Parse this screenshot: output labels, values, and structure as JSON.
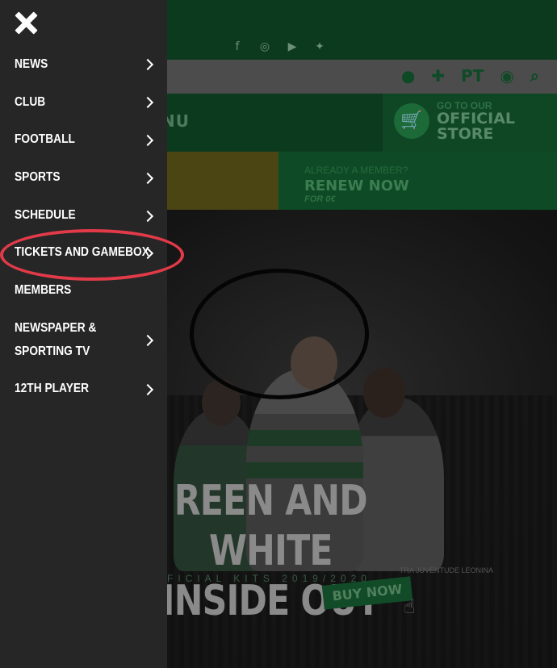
{
  "site": {
    "store_top": "GO TO OUR",
    "store_title_1": "OFFICIAL",
    "store_title_2": "STORE",
    "menu_label": "NU",
    "lang": "PT",
    "member_prompt": "ALREADY A MEMBER?",
    "renew": "RENEW NOW",
    "renew_sub": "FOR 0€",
    "hero_line1": "REEN AND WHITE",
    "hero_line2": "INSIDE OUT",
    "hero_sub": "FICIAL KITS 2019/2020",
    "hero_small": "TRA JUVENTUDE LEONINA",
    "buy_now": "BUY NOW"
  },
  "menu": {
    "items": [
      {
        "label": "NEWS",
        "has_arrow": true
      },
      {
        "label": "CLUB",
        "has_arrow": true
      },
      {
        "label": "FOOTBALL",
        "has_arrow": true
      },
      {
        "label": "SPORTS",
        "has_arrow": true
      },
      {
        "label": "SCHEDULE",
        "has_arrow": true
      },
      {
        "label": "TICKETS AND GAMEBOX",
        "has_arrow": true,
        "highlighted": true
      },
      {
        "label": "MEMBERS",
        "has_arrow": false
      },
      {
        "label": "NEWSPAPER & SPORTING TV",
        "has_arrow": true
      },
      {
        "label": "12TH PLAYER",
        "has_arrow": true
      }
    ]
  },
  "colors": {
    "menu_bg": "#262627",
    "highlight_ring": "#e23a48",
    "brand_green": "#0e4a25"
  }
}
